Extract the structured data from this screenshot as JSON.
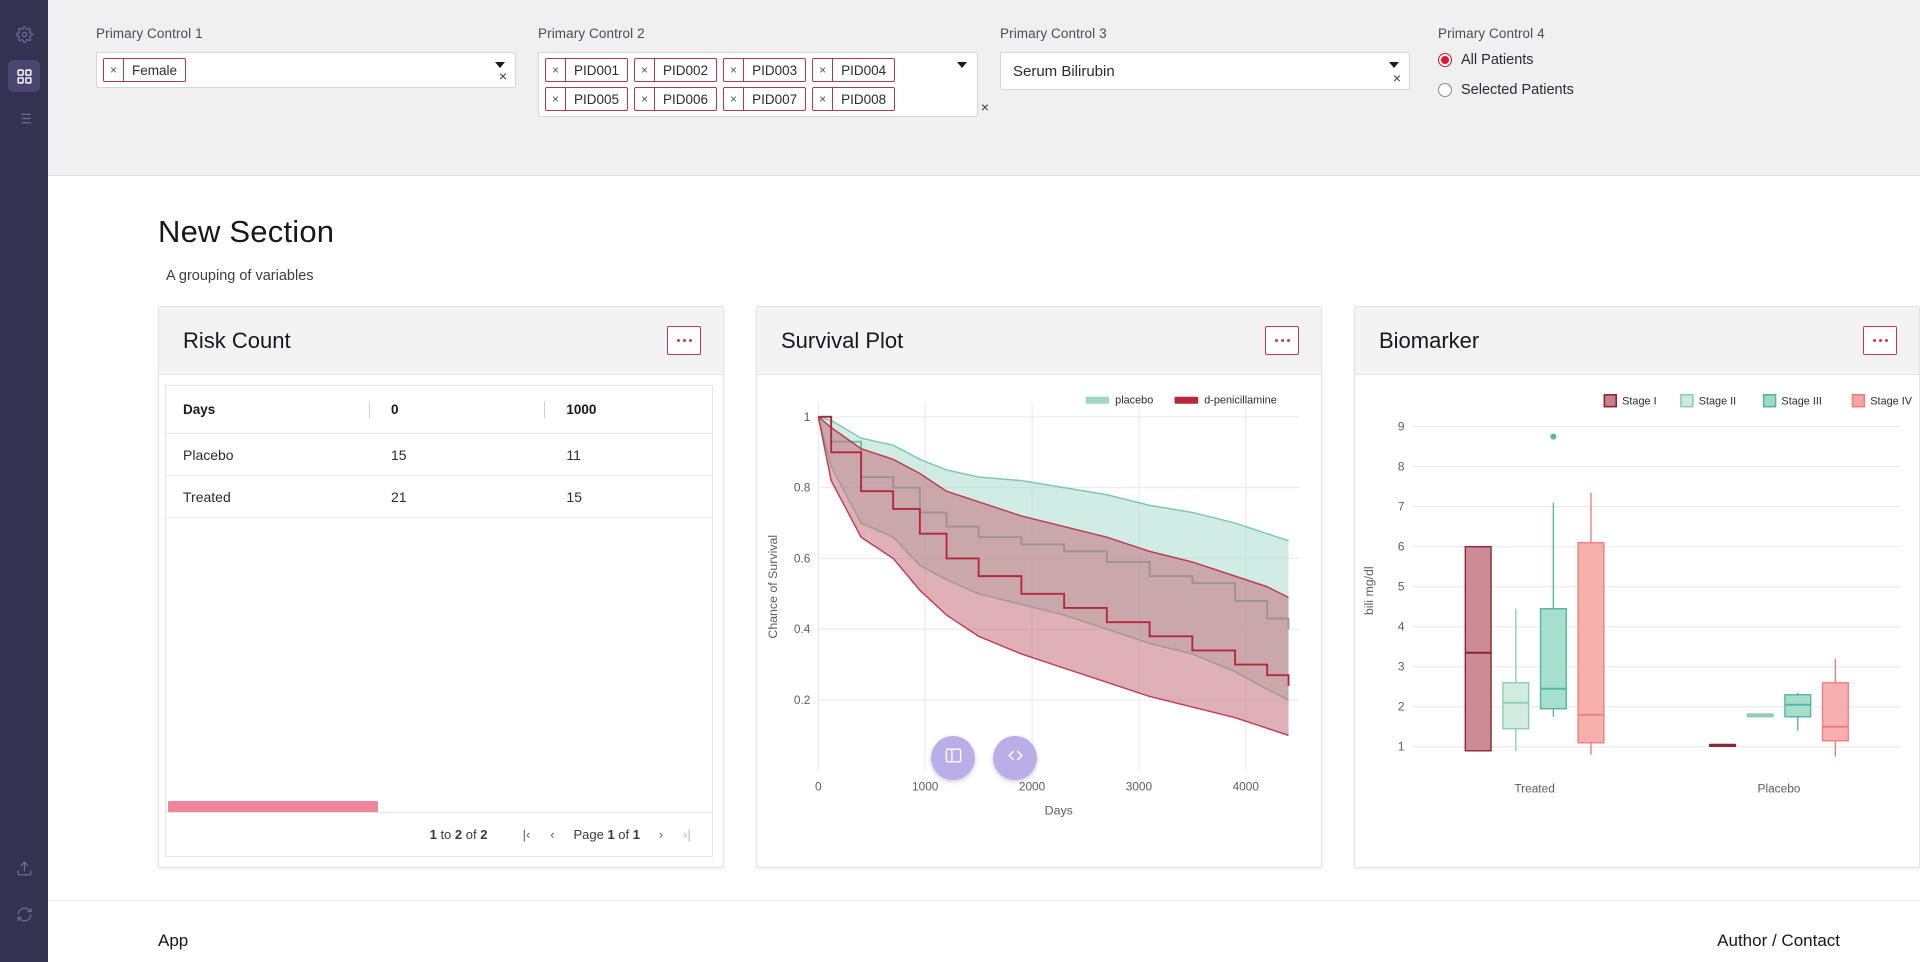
{
  "sidebar": {
    "items": [
      {
        "name": "settings",
        "icon": "gear-icon",
        "active": false
      },
      {
        "name": "dashboard",
        "icon": "grid-icon",
        "active": true
      },
      {
        "name": "list",
        "icon": "list-icon",
        "active": false
      }
    ],
    "bottom_items": [
      {
        "name": "export",
        "icon": "upload-icon"
      },
      {
        "name": "refresh",
        "icon": "refresh-icon"
      }
    ]
  },
  "controls": {
    "control1": {
      "label": "Primary Control 1",
      "chips": [
        "Female"
      ],
      "clear_glyph": "×",
      "chip_remove_glyph": "×"
    },
    "control2": {
      "label": "Primary Control 2",
      "chips": [
        "PID001",
        "PID002",
        "PID003",
        "PID004",
        "PID005",
        "PID006",
        "PID007",
        "PID008"
      ],
      "clear_glyph": "×",
      "chip_remove_glyph": "×"
    },
    "control3": {
      "label": "Primary Control 3",
      "value": "Serum Bilirubin",
      "clear_glyph": "×"
    },
    "control4": {
      "label": "Primary Control 4",
      "options": [
        {
          "label": "All Patients",
          "selected": true
        },
        {
          "label": "Selected Patients",
          "selected": false
        }
      ]
    }
  },
  "section": {
    "title": "New Section",
    "subtitle": "A grouping of variables"
  },
  "panels": {
    "risk": {
      "title": "Risk Count",
      "table": {
        "columns": [
          "Days",
          "0",
          "1000"
        ],
        "rows": [
          {
            "group": "Placebo",
            "values": [
              "15",
              "11"
            ]
          },
          {
            "group": "Treated",
            "values": [
              "21",
              "15"
            ]
          }
        ]
      },
      "footer": {
        "range_prefix": "1",
        "range_text": " to ",
        "range_mid": "2",
        "range_of": " of ",
        "range_total": "2",
        "summary": "1 to 2 of 2",
        "page_word": "Page",
        "page_current": "1",
        "page_of": " of ",
        "page_total": "1",
        "first_glyph": "|‹",
        "prev_glyph": "‹",
        "next_glyph": "›",
        "last_glyph": "›|"
      }
    },
    "survival": {
      "title": "Survival Plot"
    },
    "biomarker": {
      "title": "Biomarker"
    }
  },
  "chart_data": [
    {
      "id": "survival-plot",
      "type": "line",
      "title": "Survival Plot",
      "xlabel": "Days",
      "ylabel": "Chance of Survival",
      "xlim": [
        0,
        4500
      ],
      "ylim": [
        0,
        1.04
      ],
      "xticks": [
        0,
        1000,
        2000,
        3000,
        4000
      ],
      "yticks": [
        0.2,
        0.4,
        0.6,
        0.8,
        1
      ],
      "ytick_labels": [
        "0.2",
        "0.4",
        "0.6",
        "0.8",
        "1"
      ],
      "grid": true,
      "legend_position": "top-right",
      "legend": [
        {
          "name": "placebo",
          "color": "#9fd8c8"
        },
        {
          "name": "d-penicillamine",
          "color": "#b5283c"
        }
      ],
      "series": [
        {
          "name": "placebo",
          "color": "#6cbfa8",
          "band_color": "#a9ddcd",
          "x": [
            0,
            120,
            400,
            700,
            950,
            1200,
            1500,
            1900,
            2300,
            2700,
            3100,
            3500,
            3900,
            4200,
            4400
          ],
          "y": [
            1.0,
            0.93,
            0.83,
            0.8,
            0.73,
            0.69,
            0.66,
            0.64,
            0.62,
            0.59,
            0.55,
            0.53,
            0.48,
            0.43,
            0.4
          ],
          "upper": [
            1.0,
            0.99,
            0.94,
            0.92,
            0.88,
            0.85,
            0.83,
            0.82,
            0.8,
            0.78,
            0.75,
            0.73,
            0.7,
            0.67,
            0.65
          ],
          "lower": [
            1.0,
            0.86,
            0.7,
            0.66,
            0.58,
            0.54,
            0.5,
            0.47,
            0.44,
            0.4,
            0.36,
            0.33,
            0.28,
            0.23,
            0.2
          ]
        },
        {
          "name": "d-penicillamine",
          "color": "#b5283c",
          "band_color": "#c4707c",
          "x": [
            0,
            120,
            400,
            700,
            950,
            1200,
            1500,
            1900,
            2300,
            2700,
            3100,
            3500,
            3900,
            4200,
            4400
          ],
          "y": [
            1.0,
            0.9,
            0.79,
            0.74,
            0.67,
            0.6,
            0.55,
            0.5,
            0.46,
            0.42,
            0.38,
            0.34,
            0.3,
            0.27,
            0.24
          ],
          "upper": [
            1.0,
            0.97,
            0.91,
            0.88,
            0.84,
            0.79,
            0.76,
            0.72,
            0.69,
            0.66,
            0.62,
            0.59,
            0.55,
            0.52,
            0.49
          ],
          "lower": [
            1.0,
            0.82,
            0.66,
            0.6,
            0.51,
            0.44,
            0.38,
            0.33,
            0.29,
            0.25,
            0.21,
            0.18,
            0.15,
            0.12,
            0.1
          ]
        }
      ]
    },
    {
      "id": "biomarker-boxplot",
      "type": "box",
      "title": "Biomarker",
      "ylabel": "bili mg/dl",
      "xlabel": "",
      "ylim": [
        0.4,
        9.4
      ],
      "yticks": [
        1,
        2,
        3,
        4,
        5,
        6,
        7,
        8,
        9
      ],
      "grid": true,
      "legend_position": "top-right",
      "categories": [
        "Treated",
        "Placebo"
      ],
      "legend": [
        {
          "name": "Stage I",
          "color": "#c58089",
          "border": "#8f2233"
        },
        {
          "name": "Stage II",
          "color": "#cdeade",
          "border": "#8fcdb5"
        },
        {
          "name": "Stage III",
          "color": "#9ddbc8",
          "border": "#55b79b"
        },
        {
          "name": "Stage IV",
          "color": "#f6a7a4",
          "border": "#ef7f7d"
        }
      ],
      "boxes": [
        {
          "group": "Treated",
          "stage": "Stage I",
          "min": 0.9,
          "q1": 0.9,
          "median": 3.35,
          "q3": 6.0,
          "max": 6.0
        },
        {
          "group": "Treated",
          "stage": "Stage II",
          "min": 0.9,
          "q1": 1.45,
          "median": 2.1,
          "q3": 2.6,
          "max": 4.45
        },
        {
          "group": "Treated",
          "stage": "Stage III",
          "min": 1.75,
          "q1": 1.95,
          "median": 2.45,
          "q3": 4.45,
          "max": 7.1
        },
        {
          "group": "Treated",
          "stage": "Stage IV",
          "min": 0.8,
          "q1": 1.1,
          "median": 1.8,
          "q3": 6.1,
          "max": 7.35
        },
        {
          "group": "Placebo",
          "stage": "Stage I",
          "min": 1.05,
          "q1": 1.05,
          "median": 1.05,
          "q3": 1.05,
          "max": 1.05
        },
        {
          "group": "Placebo",
          "stage": "Stage II",
          "min": 1.75,
          "q1": 1.75,
          "median": 1.78,
          "q3": 1.82,
          "max": 1.82
        },
        {
          "group": "Placebo",
          "stage": "Stage III",
          "min": 1.4,
          "q1": 1.75,
          "median": 2.05,
          "q3": 2.3,
          "max": 2.35
        },
        {
          "group": "Placebo",
          "stage": "Stage IV",
          "min": 0.75,
          "q1": 1.15,
          "median": 1.5,
          "q3": 2.6,
          "max": 3.2
        }
      ],
      "outliers": [
        {
          "group": "Treated",
          "stage": "Stage III",
          "value": 8.75
        }
      ]
    }
  ],
  "fabs": [
    {
      "name": "layout-toggle",
      "icon": "panel-icon"
    },
    {
      "name": "code-view",
      "icon": "code-icon",
      "glyph": "</>"
    }
  ],
  "footer": {
    "left_label": "App",
    "right_label": "Author / Contact"
  }
}
